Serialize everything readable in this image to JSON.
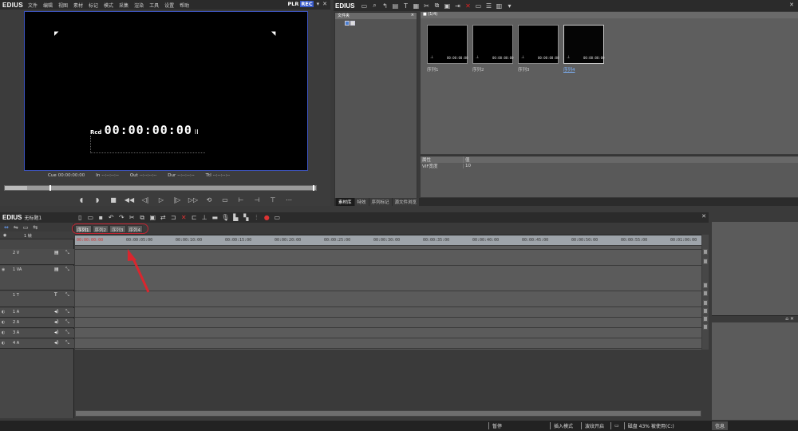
{
  "menubar": {
    "logo": "EDIUS",
    "items": [
      "文件",
      "编辑",
      "视图",
      "素材",
      "标记",
      "模式",
      "采集",
      "渲染",
      "工具",
      "设置",
      "帮助"
    ],
    "plr": "PLR",
    "rec": "REC",
    "close": "✕"
  },
  "player": {
    "tc_label": "Rcd",
    "timecode": "00:00:00:00",
    "pause_glyph": "II",
    "cue_label": "Cue",
    "cue_value": "00:00:00:00",
    "in_label": "In",
    "in_value": "--:--:--:--",
    "out_label": "Out",
    "out_value": "--:--:--:--",
    "dur_label": "Dur",
    "dur_value": "--:--:--:--",
    "ttl_label": "Ttl",
    "ttl_value": "--:--:--:--"
  },
  "bin": {
    "logo": "EDIUS",
    "close": "✕",
    "folder_title": "文件夹",
    "folder_close": "×",
    "clip_header": "■ (1/4)",
    "clips": [
      "序列1",
      "序列2",
      "序列3",
      "序列4"
    ],
    "thumb_tc": "00:00:00:00",
    "props_header": [
      "属性",
      "值"
    ],
    "props_row": [
      "VIF宽度",
      "10"
    ],
    "tabs": [
      "素材库",
      "特效",
      "序列标记",
      "源文件浏览"
    ]
  },
  "timeline": {
    "logo": "EDIUS",
    "project": "无标题1",
    "close": "✕",
    "tabs": [
      "序列1",
      "序列2",
      "序列3",
      "序列4"
    ],
    "ruler": [
      "00:00:00:00",
      "00:00:05:00",
      "00:00:10:00",
      "00:00:15:00",
      "00:00:20:00",
      "00:00:25:00",
      "00:00:30:00",
      "00:00:35:00",
      "00:00:40:00",
      "00:00:45:00",
      "00:00:50:00",
      "00:00:55:00",
      "00:01:00:00"
    ],
    "track_top": "1 帧",
    "tracks": [
      {
        "name": "2 V",
        "h": 20
      },
      {
        "name": "1 VA",
        "h": 31
      },
      {
        "name": "1 T",
        "h": 20
      },
      {
        "name": "1 A",
        "h": 12
      },
      {
        "name": "2 A",
        "h": 12
      },
      {
        "name": "3 A",
        "h": 12
      },
      {
        "name": "4 A",
        "h": 12
      }
    ]
  },
  "status": {
    "pause": "暂停",
    "insert": "插入模式",
    "ripple": "波纹开启",
    "disk": "磁盘 43% 被使用(C:)",
    "info": "信息"
  },
  "colors": {
    "accent_blue": "#3557c8",
    "annotation_red": "#d9262e"
  }
}
